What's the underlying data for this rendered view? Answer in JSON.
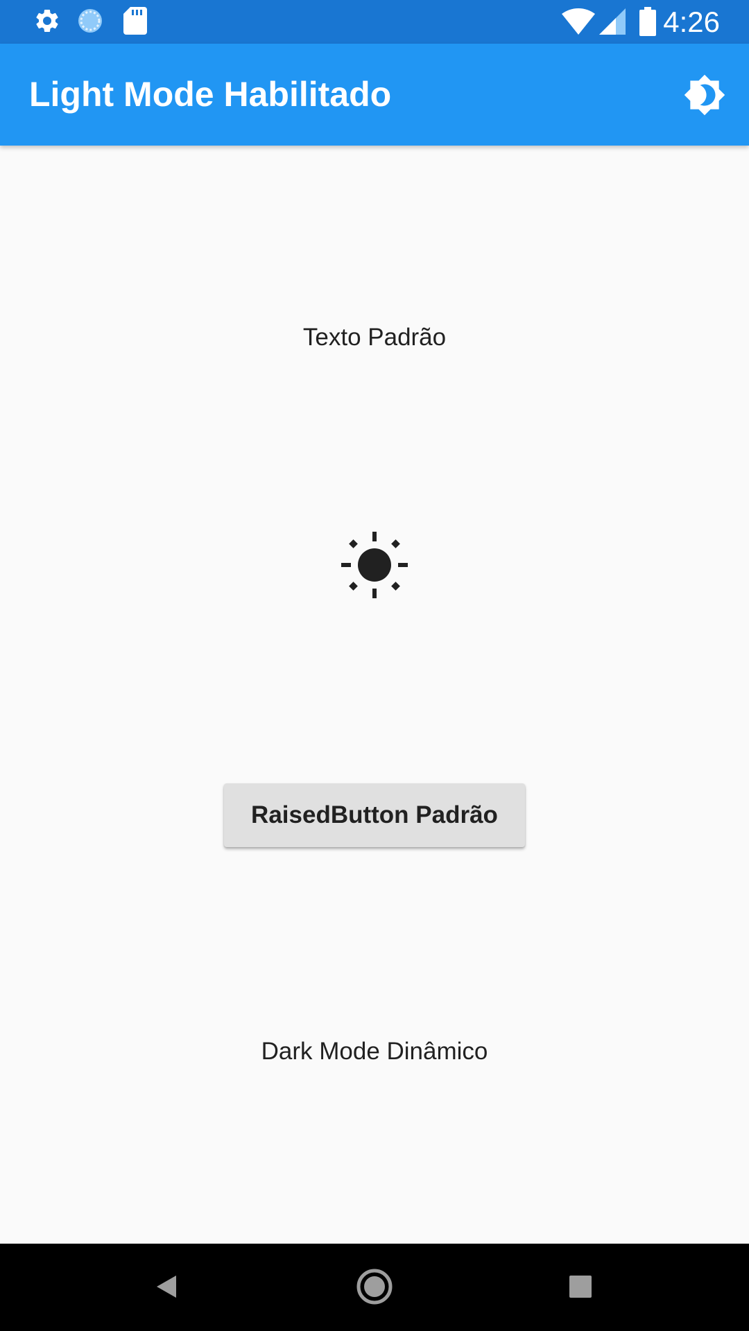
{
  "status_bar": {
    "time": "4:26",
    "left_icons": [
      "gear-icon",
      "sync-icon",
      "sd-card-icon"
    ],
    "right_icons": [
      "wifi-icon",
      "signal-icon",
      "battery-icon"
    ],
    "color": "#1976d2"
  },
  "app_bar": {
    "title": "Light Mode Habilitado",
    "action_icon": "brightness-icon",
    "color": "#2196f3"
  },
  "main": {
    "default_text": "Texto Padrão",
    "center_icon": "sun-icon",
    "button_label": "RaisedButton Padrão",
    "dynamic_text": "Dark Mode Dinâmico"
  },
  "nav_bar": {
    "buttons": [
      "back-icon",
      "home-icon",
      "recents-icon"
    ]
  }
}
